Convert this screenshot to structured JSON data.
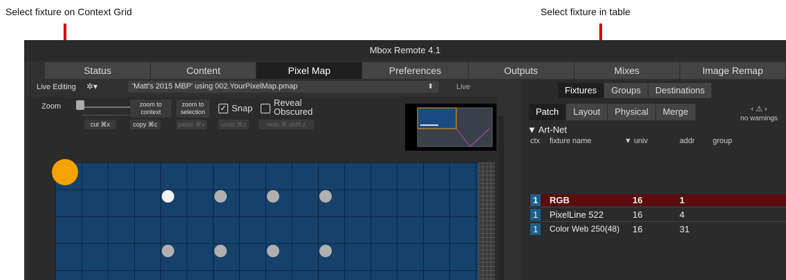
{
  "annotations": {
    "left": "Select fixture on Context Grid",
    "right": "Select fixture in table"
  },
  "window": {
    "title": "Mbox Remote 4.1"
  },
  "tabs": [
    "Status",
    "Content",
    "Pixel Map",
    "Preferences",
    "Outputs",
    "Mixes",
    "Image Remap"
  ],
  "live_row": {
    "label": "Live Editing",
    "map_select": "'Matt's 2015 MBP' using 002.YourPixelMap.pmap",
    "status": "Live"
  },
  "toolbar": {
    "zoom_label": "Zoom",
    "zoom_context": "zoom to context",
    "zoom_selection": "zoom to selection",
    "snap_label": "Snap",
    "reveal_label": "Reveal Obscured",
    "cut": "cut ⌘x",
    "copy": "copy ⌘c",
    "paste": "paste ⌘v",
    "undo": "undo ⌘z",
    "redo": "redo ⌘-shift-z"
  },
  "right_tabs": [
    "Fixtures",
    "Groups",
    "Destinations"
  ],
  "sub_tabs": [
    "Patch",
    "Layout",
    "Physical",
    "Merge"
  ],
  "warnings": "no warnings",
  "section": "▼ Art-Net",
  "columns": {
    "ctx": "ctx",
    "name": "fixture name",
    "univ": "▼ univ",
    "addr": "addr",
    "group": "group"
  },
  "rows": [
    {
      "ctx": "1",
      "name": "RGB",
      "univ": "16",
      "addr": "1",
      "selected": true
    },
    {
      "ctx": "1",
      "name": "PixelLine 522",
      "univ": "16",
      "addr": "4",
      "selected": false
    },
    {
      "ctx": "1",
      "name": "Color Web 250(48)",
      "univ": "16",
      "addr": "31",
      "selected": false
    }
  ],
  "colors": {
    "accent_red": "#e00000",
    "selection_row": "#5c0c0c",
    "grid_blue": "#15416b",
    "context_dot": "#f5a300"
  }
}
